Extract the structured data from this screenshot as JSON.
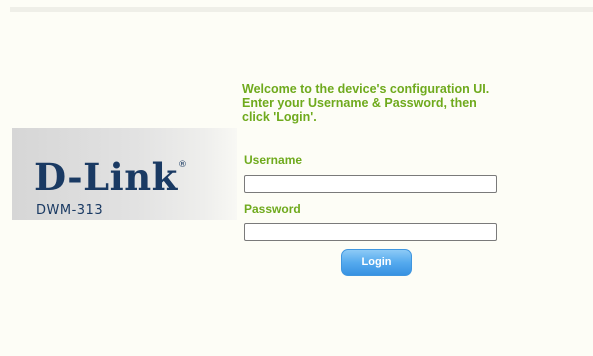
{
  "brand": {
    "logo_text": "D-Link",
    "registered_mark": "®",
    "model": "DWM-313"
  },
  "welcome": {
    "line1": "Welcome to the device's configuration UI.",
    "line2": "Enter your Username & Password, then",
    "line3": "click 'Login'."
  },
  "form": {
    "username_label": "Username",
    "username_value": "",
    "password_label": "Password",
    "password_value": "",
    "login_label": "Login"
  },
  "colors": {
    "accent_green": "#6faa1d",
    "brand_navy": "#1a3a63",
    "button_blue": "#55aaee",
    "background": "#fdfdf6"
  }
}
